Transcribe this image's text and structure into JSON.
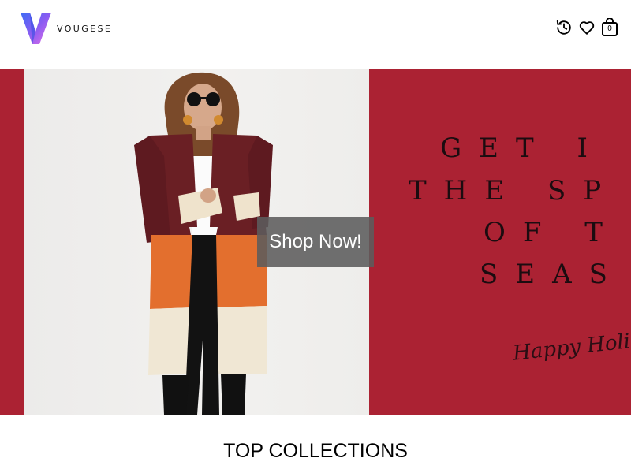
{
  "header": {
    "brand": "VOUGESE",
    "icons": [
      "history-icon",
      "heart-icon",
      "shopping-bag-icon"
    ],
    "cart_count": "0"
  },
  "banner": {
    "slogan_lines": [
      "GET I",
      "THE SP",
      "OF T",
      "SEAS"
    ],
    "script_text": "Happy Holi",
    "shop_button": "Shop Now!",
    "background_color": "#ab2233"
  },
  "section": {
    "title": "TOP COLLECTIONS"
  }
}
